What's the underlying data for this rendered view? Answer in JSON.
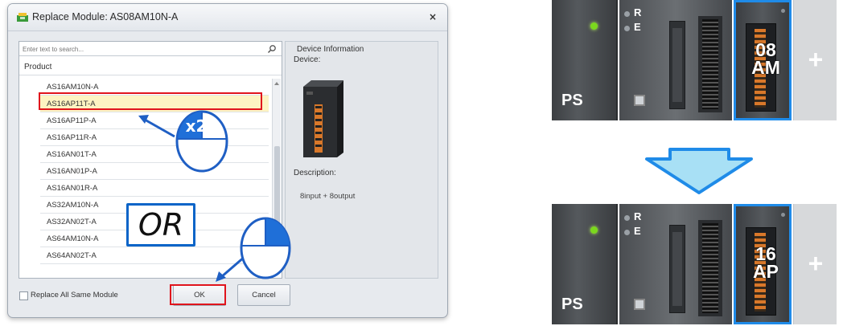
{
  "dialog": {
    "title": "Replace Module: AS08AM10N-A",
    "close_glyph": "×",
    "search": {
      "placeholder": "Enter text to search..."
    },
    "product_header": "Product",
    "products": [
      "AS16AM10N-A",
      "AS16AP11T-A",
      "AS16AP11P-A",
      "AS16AP11R-A",
      "AS16AN01T-A",
      "AS16AN01P-A",
      "AS16AN01R-A",
      "AS32AM10N-A",
      "AS32AN02T-A",
      "AS64AM10N-A",
      "AS64AN02T-A"
    ],
    "selected_index": 1,
    "device_info": {
      "title": "Device Information",
      "device_label": "Device:",
      "description_label": "Description:",
      "description_value": "8input + 8output"
    },
    "replace_all_label": "Replace All Same Module",
    "ok_label": "OK",
    "cancel_label": "Cancel"
  },
  "annotations": {
    "or_text": "OR",
    "double_click_text": "x2",
    "highlight_color": "#e0141c",
    "accent_color": "#1f8be8"
  },
  "illustration": {
    "top": {
      "ps_label": "PS",
      "cpu_r": "R",
      "cpu_e": "E",
      "io_line1": "08",
      "io_line2": "AM",
      "plus": "+"
    },
    "bottom": {
      "ps_label": "PS",
      "cpu_r": "R",
      "cpu_e": "E",
      "io_line1": "16",
      "io_line2": "AP",
      "plus": "+"
    }
  }
}
